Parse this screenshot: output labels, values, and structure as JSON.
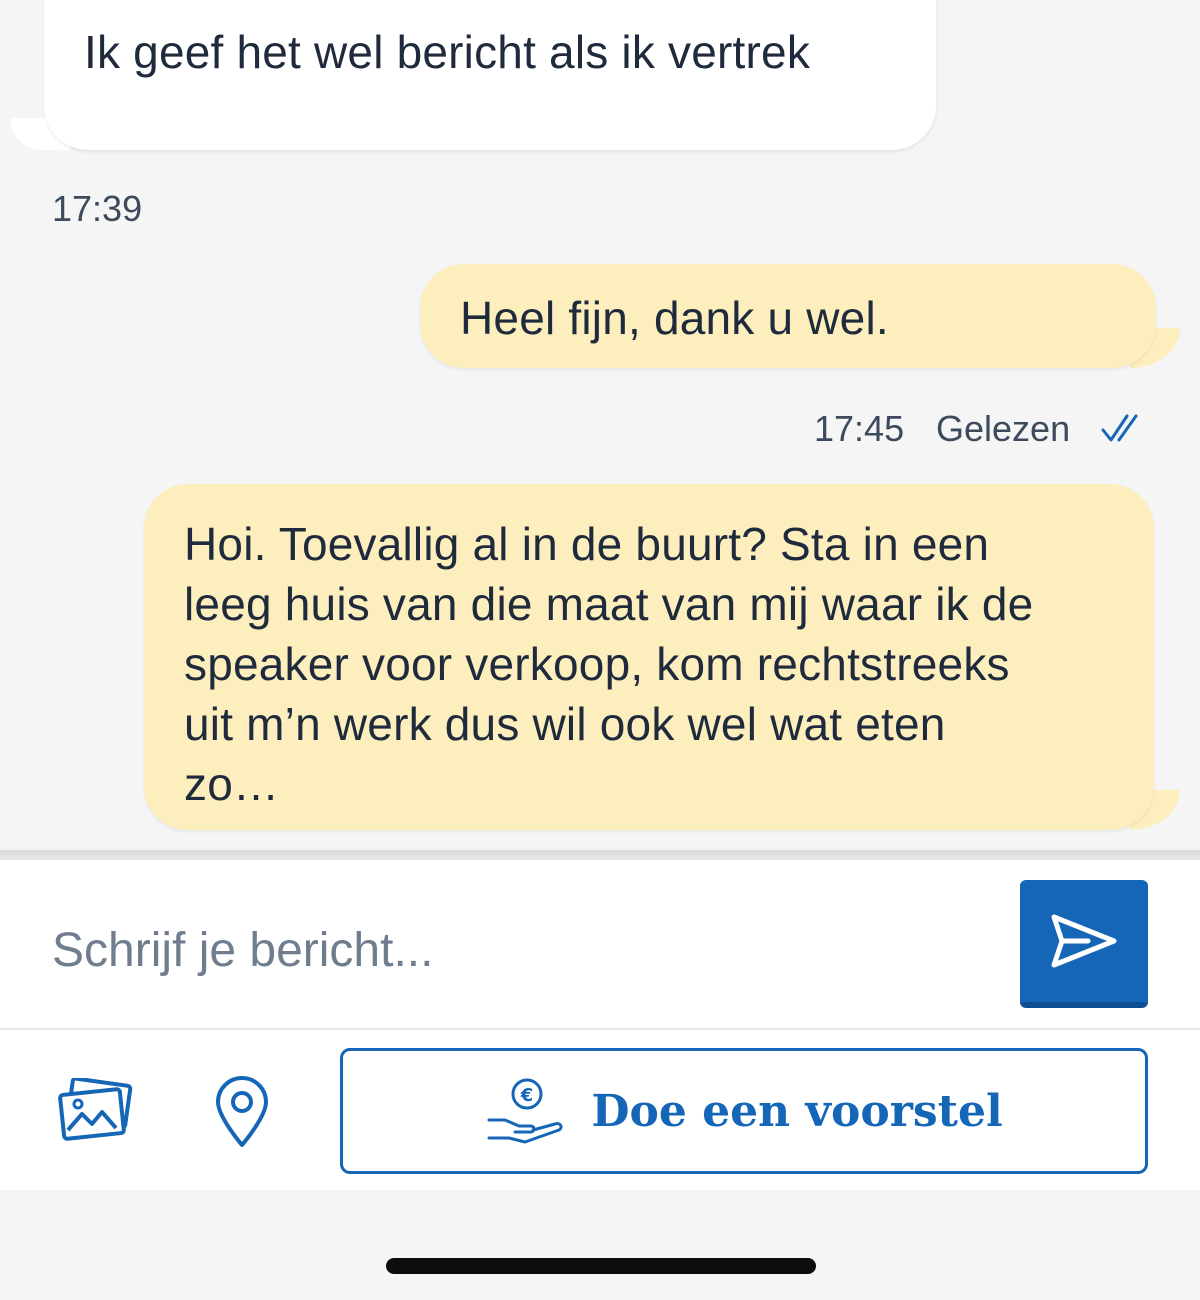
{
  "messages": [
    {
      "direction": "incoming",
      "text": "Ik geef het wel bericht als ik vertrek",
      "time": "17:39"
    },
    {
      "direction": "outgoing",
      "text": "Heel fijn, dank u wel.",
      "time": "17:45",
      "status": "Gelezen"
    },
    {
      "direction": "outgoing",
      "lines": [
        "Hoi. Toevallig al in de buurt? Sta in een",
        "leeg huis van die maat van mij waar ik de",
        "speaker voor verkoop, kom rechtstreeks",
        "uit m’n werk dus wil ook wel wat eten",
        "zo…"
      ]
    }
  ],
  "composer": {
    "placeholder": "Schrijf je bericht...",
    "send_icon": "send-icon"
  },
  "actions": {
    "photo_icon": "photos-icon",
    "location_icon": "location-pin-icon",
    "offer_icon": "hand-euro-icon",
    "offer_label": "Doe een voorstel"
  },
  "colors": {
    "outgoing_bubble": "#fdeebe",
    "incoming_bubble": "#ffffff",
    "accent": "#1566b7",
    "background": "#f5f5f6"
  }
}
